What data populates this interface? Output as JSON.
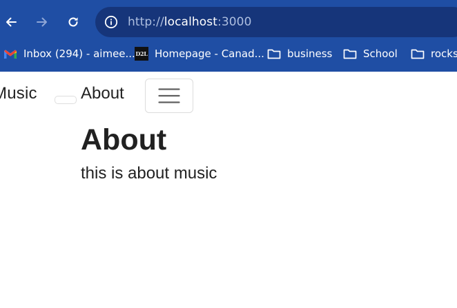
{
  "browser": {
    "url_scheme": "http://",
    "url_host": "localhost",
    "url_port": ":3000",
    "icons": {
      "back": "arrow-left-icon",
      "forward": "arrow-right-icon",
      "reload": "reload-icon",
      "site_info": "info-icon"
    },
    "colors": {
      "chrome": "#1f4ea4",
      "omnibox": "#16357a"
    },
    "bookmarks": [
      {
        "label": "Inbox (294) - aimee....",
        "icon": "gmail-icon"
      },
      {
        "label": "Homepage - Canad...",
        "icon": "d2l-icon",
        "icon_text": "D2L"
      },
      {
        "label": "business",
        "icon": "folder-icon"
      },
      {
        "label": "School",
        "icon": "folder-icon"
      },
      {
        "label": "rocks",
        "icon": "folder-icon"
      }
    ]
  },
  "site": {
    "brand": "Music",
    "nav_links": [
      {
        "label": "About"
      }
    ],
    "toggler_icon": "hamburger-menu-icon"
  },
  "main": {
    "title": "About",
    "text": "this is about music"
  }
}
